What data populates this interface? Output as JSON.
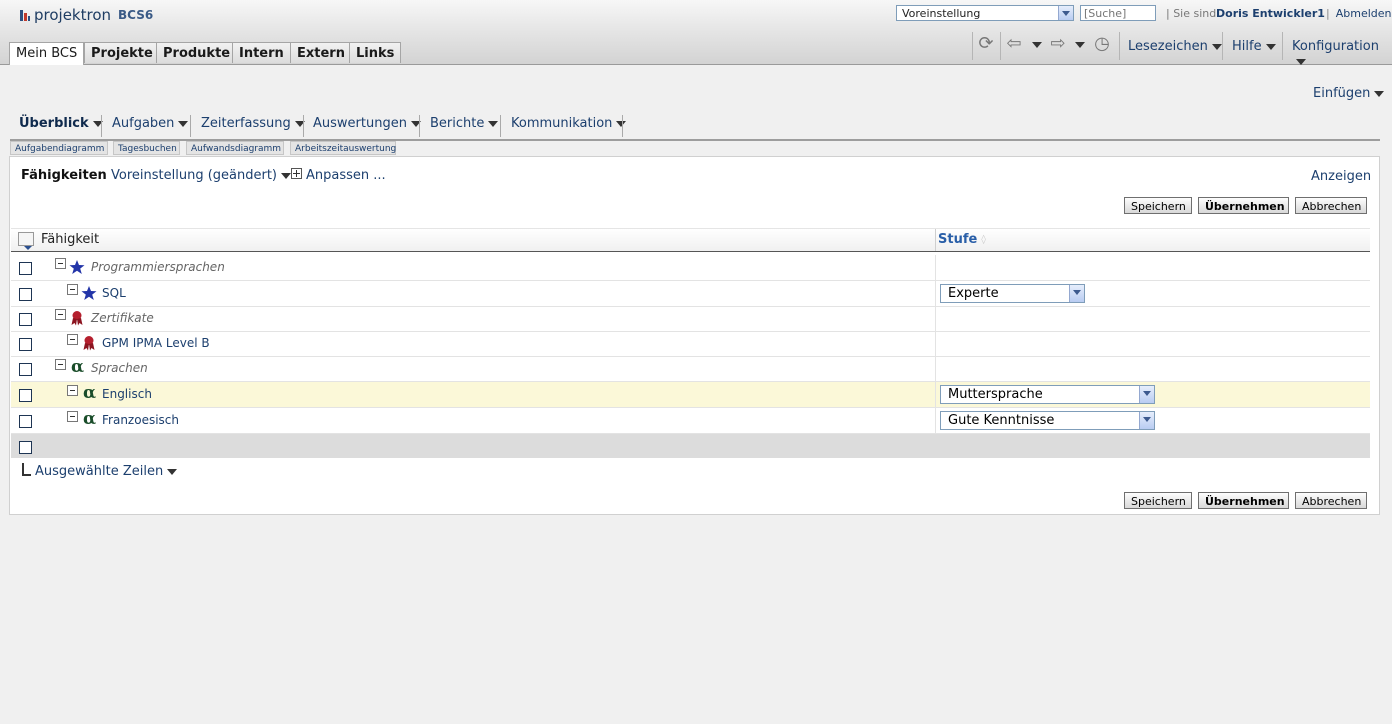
{
  "app": {
    "name": "projektron",
    "version": "BCS6"
  },
  "header": {
    "profile_select": "Voreinstellung",
    "search_placeholder": "[Suche]",
    "you_are": "| Sie sind",
    "user": "Doris Entwickler1",
    "logout": "Abmelden",
    "tabs": [
      "Mein BCS",
      "Projekte",
      "Produkte",
      "Intern",
      "Extern",
      "Links"
    ],
    "menus": {
      "bookmarks": "Lesezeichen",
      "help": "Hilfe",
      "config": "Konfiguration"
    }
  },
  "insert": "Einfügen",
  "nav": [
    "Überblick",
    "Aufgaben",
    "Zeiterfassung",
    "Auswertungen",
    "Berichte",
    "Kommunikation"
  ],
  "subtabs": [
    "Aufgabendiagramm",
    "Tagesbuchen",
    "Aufwandsdiagramm",
    "Arbeitszeitauswertung"
  ],
  "view": {
    "title": "Fähigkeiten",
    "preset": "Voreinstellung (geändert)",
    "adjust": "Anpassen ...",
    "show": "Anzeigen"
  },
  "buttons": {
    "save": "Speichern",
    "apply": "Übernehmen",
    "cancel": "Abbrechen"
  },
  "table": {
    "col_skill": "Fähigkeit",
    "col_level": "Stufe",
    "rows": [
      {
        "label": "Programmiersprachen",
        "level": ""
      },
      {
        "label": "SQL",
        "level": "Experte"
      },
      {
        "label": "Zertifikate",
        "level": ""
      },
      {
        "label": "GPM IPMA Level B",
        "level": ""
      },
      {
        "label": "Sprachen",
        "level": ""
      },
      {
        "label": "Englisch",
        "level": "Muttersprache"
      },
      {
        "label": "Franzoesisch",
        "level": "Gute Kenntnisse"
      }
    ]
  },
  "selected_rows": "Ausgewählte Zeilen",
  "colors": {
    "link": "#1c3f6e",
    "highlight_row": "#fbf8d8",
    "footer_row": "#dcdcdc"
  },
  "icons": {
    "programming": "star-icon",
    "certificate": "ribbon-icon",
    "language": "alpha-icon"
  }
}
